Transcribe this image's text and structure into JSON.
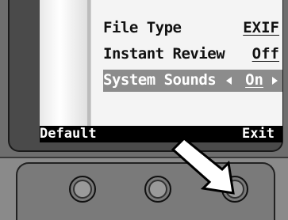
{
  "menu": {
    "items": [
      {
        "label": "File Type",
        "value": "EXIF"
      },
      {
        "label": "Instant Review",
        "value": "Off"
      },
      {
        "label": "System Sounds",
        "value": "On"
      }
    ]
  },
  "softkeys": {
    "left": "Default",
    "right": "Exit"
  }
}
